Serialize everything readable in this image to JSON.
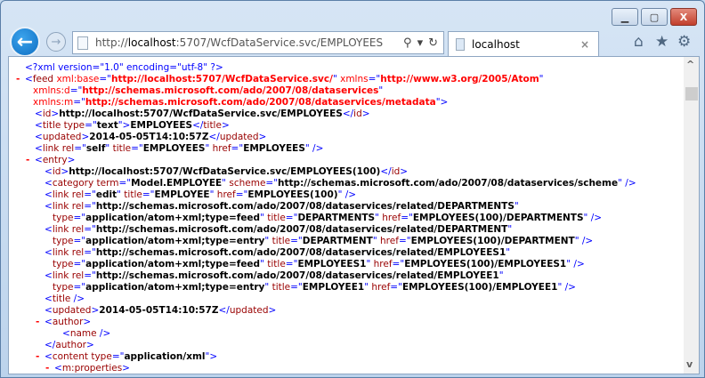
{
  "window": {
    "minimize": "▁",
    "maximize": "▢",
    "close": "X"
  },
  "nav": {
    "back": "←",
    "forward": "→"
  },
  "address": {
    "prefix": "http://",
    "host": "localhost",
    "rest": ":5707/WcfDataService.svc/EMPLOYEES",
    "search_icon": "⚲",
    "dropdown": "▾",
    "refresh": "↻"
  },
  "tab": {
    "title": "localhost",
    "close": "×"
  },
  "toolbar": {
    "home": "⌂",
    "favorites": "★",
    "tools": "⚙"
  },
  "scrollbar": {
    "up": "^",
    "down": "v",
    "position": 0
  },
  "xml": [
    {
      "d": 0,
      "s": [
        [
          "pi",
          "<?xml version=\"1.0\" encoding=\"utf-8\" ?>"
        ]
      ]
    },
    {
      "d": 0,
      "minus": "-",
      "s": [
        [
          "m",
          "<"
        ],
        [
          "t",
          "feed"
        ],
        [
          "ns",
          " xml:base"
        ],
        [
          "m",
          "=\""
        ],
        [
          "nv",
          "http://localhost:5707/WcfDataService.svc/"
        ],
        [
          "m",
          "\""
        ],
        [
          "ns",
          " xmlns"
        ],
        [
          "m",
          "=\""
        ],
        [
          "nv",
          "http://www.w3.org/2005/Atom"
        ],
        [
          "m",
          "\""
        ]
      ]
    },
    {
      "d": 0,
      "c": 1,
      "s": [
        [
          "ns",
          "xmlns:d"
        ],
        [
          "m",
          "=\""
        ],
        [
          "nv",
          "http://schemas.microsoft.com/ado/2007/08/dataservices"
        ],
        [
          "m",
          "\""
        ]
      ]
    },
    {
      "d": 0,
      "c": 1,
      "s": [
        [
          "ns",
          "xmlns:m"
        ],
        [
          "m",
          "=\""
        ],
        [
          "nv",
          "http://schemas.microsoft.com/ado/2007/08/dataservices/metadata"
        ],
        [
          "m",
          "\">"
        ]
      ]
    },
    {
      "d": 1,
      "s": [
        [
          "m",
          "<"
        ],
        [
          "t",
          "id"
        ],
        [
          "m",
          ">"
        ],
        [
          "x",
          "http://localhost:5707/WcfDataService.svc/EMPLOYEES"
        ],
        [
          "m",
          "</"
        ],
        [
          "t",
          "id"
        ],
        [
          "m",
          ">"
        ]
      ]
    },
    {
      "d": 1,
      "s": [
        [
          "m",
          "<"
        ],
        [
          "t",
          "title"
        ],
        [
          "t",
          " type"
        ],
        [
          "m",
          "=\""
        ],
        [
          "v",
          "text"
        ],
        [
          "m",
          "\">"
        ],
        [
          "x",
          "EMPLOYEES"
        ],
        [
          "m",
          "</"
        ],
        [
          "t",
          "title"
        ],
        [
          "m",
          ">"
        ]
      ]
    },
    {
      "d": 1,
      "s": [
        [
          "m",
          "<"
        ],
        [
          "t",
          "updated"
        ],
        [
          "m",
          ">"
        ],
        [
          "x",
          "2014-05-05T14:10:57Z"
        ],
        [
          "m",
          "</"
        ],
        [
          "t",
          "updated"
        ],
        [
          "m",
          ">"
        ]
      ]
    },
    {
      "d": 1,
      "s": [
        [
          "m",
          "<"
        ],
        [
          "t",
          "link"
        ],
        [
          "t",
          " rel"
        ],
        [
          "m",
          "=\""
        ],
        [
          "v",
          "self"
        ],
        [
          "m",
          "\""
        ],
        [
          "t",
          " title"
        ],
        [
          "m",
          "=\""
        ],
        [
          "v",
          "EMPLOYEES"
        ],
        [
          "m",
          "\""
        ],
        [
          "t",
          " href"
        ],
        [
          "m",
          "=\""
        ],
        [
          "v",
          "EMPLOYEES"
        ],
        [
          "m",
          "\" />"
        ]
      ]
    },
    {
      "d": 1,
      "minus": "-",
      "s": [
        [
          "m",
          "<"
        ],
        [
          "t",
          "entry"
        ],
        [
          "m",
          ">"
        ]
      ]
    },
    {
      "d": 2,
      "s": [
        [
          "m",
          "<"
        ],
        [
          "t",
          "id"
        ],
        [
          "m",
          ">"
        ],
        [
          "x",
          "http://localhost:5707/WcfDataService.svc/EMPLOYEES(100)"
        ],
        [
          "m",
          "</"
        ],
        [
          "t",
          "id"
        ],
        [
          "m",
          ">"
        ]
      ]
    },
    {
      "d": 2,
      "s": [
        [
          "m",
          "<"
        ],
        [
          "t",
          "category"
        ],
        [
          "t",
          " term"
        ],
        [
          "m",
          "=\""
        ],
        [
          "v",
          "Model.EMPLOYEE"
        ],
        [
          "m",
          "\""
        ],
        [
          "t",
          " scheme"
        ],
        [
          "m",
          "=\""
        ],
        [
          "v",
          "http://schemas.microsoft.com/ado/2007/08/dataservices/scheme"
        ],
        [
          "m",
          "\" />"
        ]
      ]
    },
    {
      "d": 2,
      "s": [
        [
          "m",
          "<"
        ],
        [
          "t",
          "link"
        ],
        [
          "t",
          " rel"
        ],
        [
          "m",
          "=\""
        ],
        [
          "v",
          "edit"
        ],
        [
          "m",
          "\""
        ],
        [
          "t",
          " title"
        ],
        [
          "m",
          "=\""
        ],
        [
          "v",
          "EMPLOYEE"
        ],
        [
          "m",
          "\""
        ],
        [
          "t",
          " href"
        ],
        [
          "m",
          "=\""
        ],
        [
          "v",
          "EMPLOYEES(100)"
        ],
        [
          "m",
          "\" />"
        ]
      ]
    },
    {
      "d": 2,
      "s": [
        [
          "m",
          "<"
        ],
        [
          "t",
          "link"
        ],
        [
          "t",
          " rel"
        ],
        [
          "m",
          "=\""
        ],
        [
          "v",
          "http://schemas.microsoft.com/ado/2007/08/dataservices/related/DEPARTMENTS"
        ],
        [
          "m",
          "\""
        ]
      ]
    },
    {
      "d": 2,
      "c": 1,
      "s": [
        [
          "t",
          "type"
        ],
        [
          "m",
          "=\""
        ],
        [
          "v",
          "application/atom+xml;type=feed"
        ],
        [
          "m",
          "\""
        ],
        [
          "t",
          " title"
        ],
        [
          "m",
          "=\""
        ],
        [
          "v",
          "DEPARTMENTS"
        ],
        [
          "m",
          "\""
        ],
        [
          "t",
          " href"
        ],
        [
          "m",
          "=\""
        ],
        [
          "v",
          "EMPLOYEES(100)/DEPARTMENTS"
        ],
        [
          "m",
          "\" />"
        ]
      ]
    },
    {
      "d": 2,
      "s": [
        [
          "m",
          "<"
        ],
        [
          "t",
          "link"
        ],
        [
          "t",
          " rel"
        ],
        [
          "m",
          "=\""
        ],
        [
          "v",
          "http://schemas.microsoft.com/ado/2007/08/dataservices/related/DEPARTMENT"
        ],
        [
          "m",
          "\""
        ]
      ]
    },
    {
      "d": 2,
      "c": 1,
      "s": [
        [
          "t",
          "type"
        ],
        [
          "m",
          "=\""
        ],
        [
          "v",
          "application/atom+xml;type=entry"
        ],
        [
          "m",
          "\""
        ],
        [
          "t",
          " title"
        ],
        [
          "m",
          "=\""
        ],
        [
          "v",
          "DEPARTMENT"
        ],
        [
          "m",
          "\""
        ],
        [
          "t",
          " href"
        ],
        [
          "m",
          "=\""
        ],
        [
          "v",
          "EMPLOYEES(100)/DEPARTMENT"
        ],
        [
          "m",
          "\" />"
        ]
      ]
    },
    {
      "d": 2,
      "s": [
        [
          "m",
          "<"
        ],
        [
          "t",
          "link"
        ],
        [
          "t",
          " rel"
        ],
        [
          "m",
          "=\""
        ],
        [
          "v",
          "http://schemas.microsoft.com/ado/2007/08/dataservices/related/EMPLOYEES1"
        ],
        [
          "m",
          "\""
        ]
      ]
    },
    {
      "d": 2,
      "c": 1,
      "s": [
        [
          "t",
          "type"
        ],
        [
          "m",
          "=\""
        ],
        [
          "v",
          "application/atom+xml;type=feed"
        ],
        [
          "m",
          "\""
        ],
        [
          "t",
          " title"
        ],
        [
          "m",
          "=\""
        ],
        [
          "v",
          "EMPLOYEES1"
        ],
        [
          "m",
          "\""
        ],
        [
          "t",
          " href"
        ],
        [
          "m",
          "=\""
        ],
        [
          "v",
          "EMPLOYEES(100)/EMPLOYEES1"
        ],
        [
          "m",
          "\" />"
        ]
      ]
    },
    {
      "d": 2,
      "s": [
        [
          "m",
          "<"
        ],
        [
          "t",
          "link"
        ],
        [
          "t",
          " rel"
        ],
        [
          "m",
          "=\""
        ],
        [
          "v",
          "http://schemas.microsoft.com/ado/2007/08/dataservices/related/EMPLOYEE1"
        ],
        [
          "m",
          "\""
        ]
      ]
    },
    {
      "d": 2,
      "c": 1,
      "s": [
        [
          "t",
          "type"
        ],
        [
          "m",
          "=\""
        ],
        [
          "v",
          "application/atom+xml;type=entry"
        ],
        [
          "m",
          "\""
        ],
        [
          "t",
          " title"
        ],
        [
          "m",
          "=\""
        ],
        [
          "v",
          "EMPLOYEE1"
        ],
        [
          "m",
          "\""
        ],
        [
          "t",
          " href"
        ],
        [
          "m",
          "=\""
        ],
        [
          "v",
          "EMPLOYEES(100)/EMPLOYEE1"
        ],
        [
          "m",
          "\" />"
        ]
      ]
    },
    {
      "d": 2,
      "s": [
        [
          "m",
          "<"
        ],
        [
          "t",
          "title"
        ],
        [
          "m",
          " />"
        ]
      ]
    },
    {
      "d": 2,
      "s": [
        [
          "m",
          "<"
        ],
        [
          "t",
          "updated"
        ],
        [
          "m",
          ">"
        ],
        [
          "x",
          "2014-05-05T14:10:57Z"
        ],
        [
          "m",
          "</"
        ],
        [
          "t",
          "updated"
        ],
        [
          "m",
          ">"
        ]
      ]
    },
    {
      "d": 2,
      "minus": "-",
      "s": [
        [
          "m",
          "<"
        ],
        [
          "t",
          "author"
        ],
        [
          "m",
          ">"
        ]
      ]
    },
    {
      "d": 3,
      "c": 1,
      "s": [
        [
          "m",
          "<"
        ],
        [
          "t",
          "name"
        ],
        [
          "m",
          " />"
        ]
      ]
    },
    {
      "d": 2,
      "s": [
        [
          "m",
          "</"
        ],
        [
          "t",
          "author"
        ],
        [
          "m",
          ">"
        ]
      ]
    },
    {
      "d": 2,
      "minus": "-",
      "s": [
        [
          "m",
          "<"
        ],
        [
          "t",
          "content"
        ],
        [
          "t",
          " type"
        ],
        [
          "m",
          "=\""
        ],
        [
          "v",
          "application/xml"
        ],
        [
          "m",
          "\">"
        ]
      ]
    },
    {
      "d": 3,
      "minus": "-",
      "s": [
        [
          "m",
          "<"
        ],
        [
          "t",
          "m:properties"
        ],
        [
          "m",
          ">"
        ]
      ]
    }
  ]
}
